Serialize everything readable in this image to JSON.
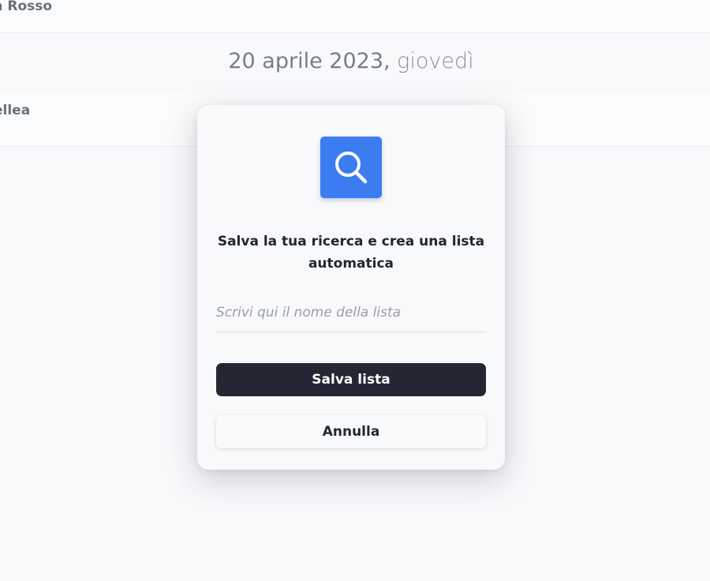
{
  "background": {
    "top_row_text": "a Rosso",
    "date_heading": {
      "date": "20 aprile 2023",
      "separator": ", ",
      "weekday": "giovedì"
    },
    "middle_row_text": "ellea"
  },
  "modal": {
    "icon": "search-icon",
    "icon_color": "#3b7cf0",
    "title": "Salva la tua ricerca e crea una lista automatica",
    "name_input": {
      "value": "",
      "placeholder": "Scrivi qui il nome della lista"
    },
    "save_label": "Salva lista",
    "cancel_label": "Annulla"
  },
  "colors": {
    "primary_button": "#242733",
    "accent": "#3b7cf0"
  }
}
